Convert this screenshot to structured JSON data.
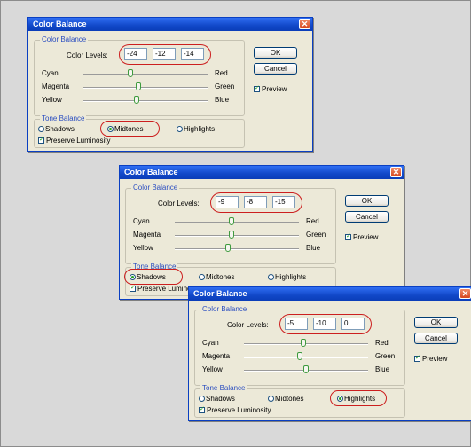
{
  "dialogs": [
    {
      "title": "Color Balance",
      "close_glyph": "✕",
      "color_balance_group": "Color Balance",
      "color_levels_label": "Color Levels:",
      "levels": [
        "-24",
        "-12",
        "-14"
      ],
      "sliders": [
        {
          "left": "Cyan",
          "right": "Red",
          "value": -24
        },
        {
          "left": "Magenta",
          "right": "Green",
          "value": -12
        },
        {
          "left": "Yellow",
          "right": "Blue",
          "value": -14
        }
      ],
      "tone_balance_group": "Tone Balance",
      "tones": [
        "Shadows",
        "Midtones",
        "Highlights"
      ],
      "selected_tone": "Midtones",
      "preserve_luminosity": "Preserve Luminosity",
      "ok_label": "OK",
      "cancel_label": "Cancel",
      "preview_label": "Preview"
    },
    {
      "title": "Color Balance",
      "close_glyph": "✕",
      "color_balance_group": "Color Balance",
      "color_levels_label": "Color Levels:",
      "levels": [
        "-9",
        "-8",
        "-15"
      ],
      "sliders": [
        {
          "left": "Cyan",
          "right": "Red",
          "value": -9
        },
        {
          "left": "Magenta",
          "right": "Green",
          "value": -8
        },
        {
          "left": "Yellow",
          "right": "Blue",
          "value": -15
        }
      ],
      "tone_balance_group": "Tone Balance",
      "tones": [
        "Shadows",
        "Midtones",
        "Highlights"
      ],
      "selected_tone": "Shadows",
      "preserve_luminosity": "Preserve Luminosity",
      "ok_label": "OK",
      "cancel_label": "Cancel",
      "preview_label": "Preview"
    },
    {
      "title": "Color Balance",
      "close_glyph": "✕",
      "color_balance_group": "Color Balance",
      "color_levels_label": "Color Levels:",
      "levels": [
        "-5",
        "-10",
        "0"
      ],
      "sliders": [
        {
          "left": "Cyan",
          "right": "Red",
          "value": -5
        },
        {
          "left": "Magenta",
          "right": "Green",
          "value": -10
        },
        {
          "left": "Yellow",
          "right": "Blue",
          "value": 0
        }
      ],
      "tone_balance_group": "Tone Balance",
      "tones": [
        "Shadows",
        "Midtones",
        "Highlights"
      ],
      "selected_tone": "Highlights",
      "preserve_luminosity": "Preserve Luminosity",
      "ok_label": "OK",
      "cancel_label": "Cancel",
      "preview_label": "Preview"
    }
  ],
  "colors": {
    "titlebar": "#1148c8",
    "highlight_marker": "#cc1f1f",
    "dialog_bg": "#ece9d8"
  }
}
